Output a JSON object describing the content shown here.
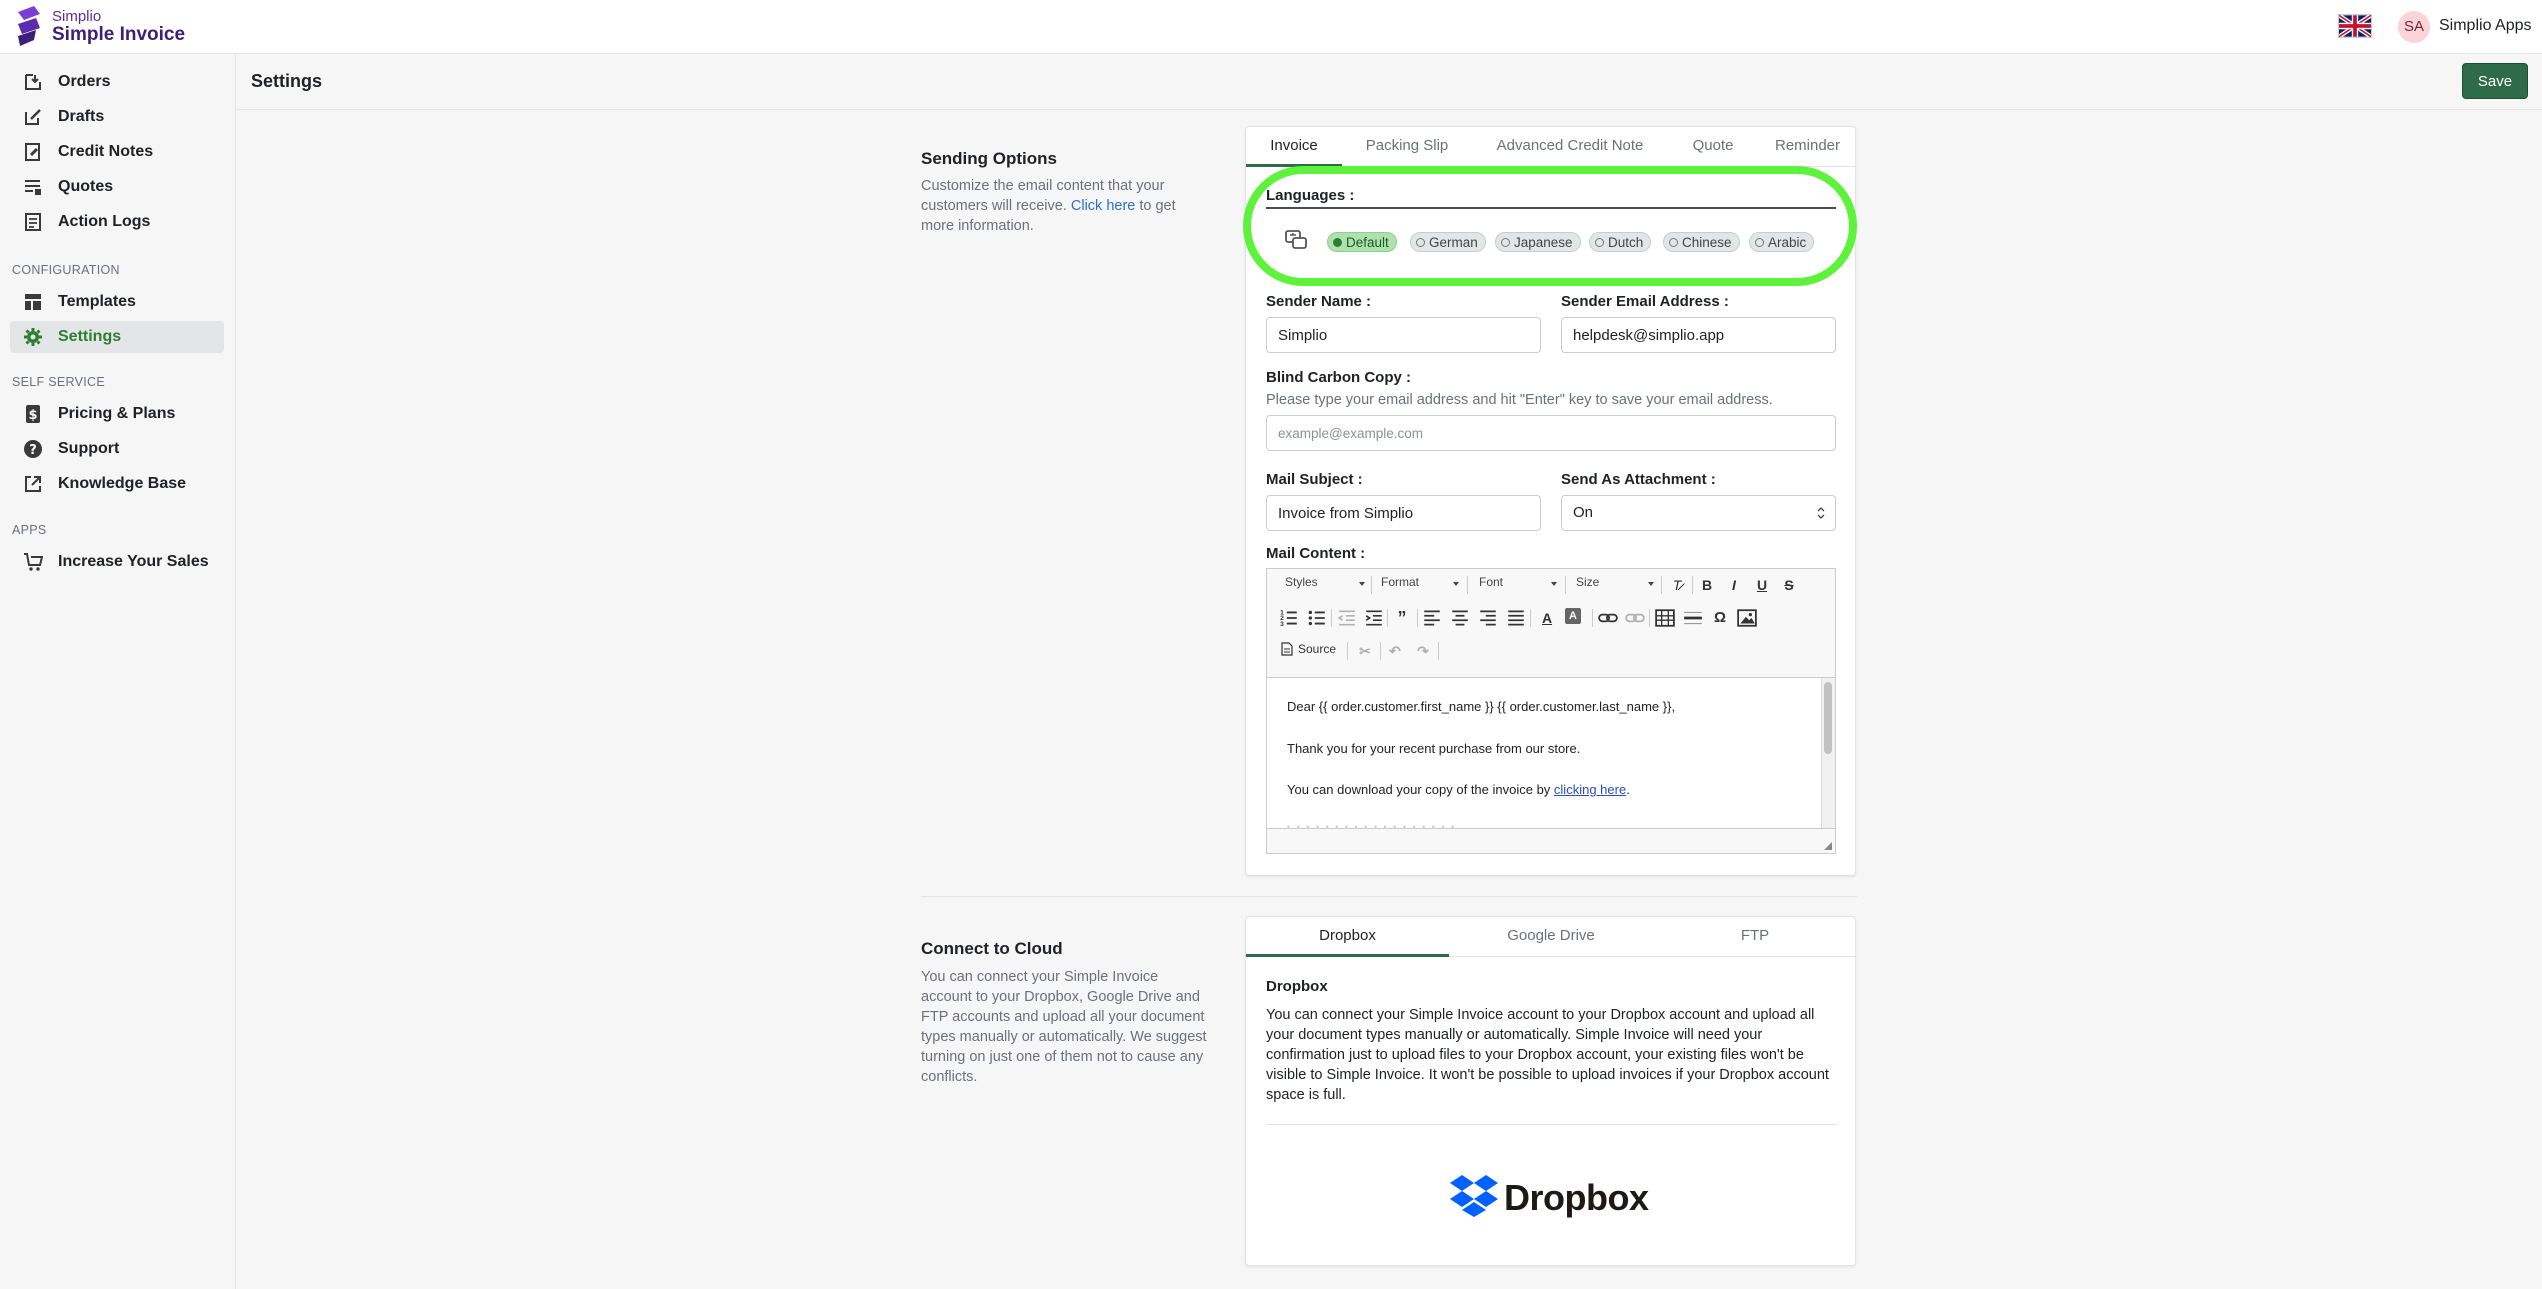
{
  "app": {
    "brand_top": "Simplio",
    "brand_main": "Simple Invoice",
    "user_initials": "SA",
    "user_name": "Simplio Apps"
  },
  "sidebar": {
    "items": [
      {
        "label": "Orders",
        "icon": "orders-icon"
      },
      {
        "label": "Drafts",
        "icon": "drafts-icon"
      },
      {
        "label": "Credit Notes",
        "icon": "credit-notes-icon"
      },
      {
        "label": "Quotes",
        "icon": "quotes-icon"
      },
      {
        "label": "Action Logs",
        "icon": "action-logs-icon"
      }
    ],
    "config_heading": "CONFIGURATION",
    "config_items": [
      {
        "label": "Templates",
        "icon": "templates-icon"
      },
      {
        "label": "Settings",
        "icon": "gear-icon",
        "active": true
      }
    ],
    "self_service_heading": "SELF SERVICE",
    "self_service_items": [
      {
        "label": "Pricing & Plans",
        "icon": "dollar-icon"
      },
      {
        "label": "Support",
        "icon": "help-icon"
      },
      {
        "label": "Knowledge Base",
        "icon": "external-link-icon"
      }
    ],
    "apps_heading": "APPS",
    "apps_items": [
      {
        "label": "Increase Your Sales",
        "icon": "cart-icon"
      }
    ]
  },
  "header": {
    "title": "Settings",
    "save_label": "Save"
  },
  "sending_options": {
    "title": "Sending Options",
    "desc_before": "Customize the email content that your customers will receive. ",
    "desc_link": "Click here",
    "desc_after": " to get more information.",
    "tabs": [
      "Invoice",
      "Packing Slip",
      "Advanced Credit Note",
      "Quote",
      "Reminder"
    ],
    "active_tab": "Invoice",
    "languages_label": "Languages :",
    "languages": [
      "Default",
      "German",
      "Japanese",
      "Dutch",
      "Chinese",
      "Arabic"
    ],
    "selected_language": "Default",
    "sender_name_label": "Sender Name :",
    "sender_name_value": "Simplio",
    "sender_email_label": "Sender Email Address :",
    "sender_email_value": "helpdesk@simplio.app",
    "bcc_label": "Blind Carbon Copy :",
    "bcc_help": "Please type your email address and hit \"Enter\" key to save your email address.",
    "bcc_placeholder": "example@example.com",
    "mail_subject_label": "Mail Subject :",
    "mail_subject_value": "Invoice from Simplio",
    "attachment_label": "Send As Attachment :",
    "attachment_value": "On",
    "mail_content_label": "Mail Content :",
    "toolbar": {
      "styles": "Styles",
      "format": "Format",
      "font": "Font",
      "size": "Size",
      "source": "Source"
    },
    "content_lines": {
      "line1": "Dear {{ order.customer.first_name }} {{ order.customer.last_name }},",
      "line2": "Thank you for your recent purchase from our store.",
      "line3_before": "You can download your copy of the invoice by ",
      "line3_link": "clicking here",
      "line3_after": "."
    }
  },
  "cloud": {
    "title": "Connect to Cloud",
    "desc": "You can connect your Simple Invoice account to your Dropbox, Google Drive and FTP accounts and upload all your document types manually or automatically. We suggest turning on just one of them not to cause any conflicts.",
    "tabs": [
      "Dropbox",
      "Google Drive",
      "FTP"
    ],
    "active_tab": "Dropbox",
    "panel_title": "Dropbox",
    "panel_text": "You can connect your Simple Invoice account to your Dropbox account and upload all your document types manually or automatically. Simple Invoice will need your confirmation just to upload files to your Dropbox account, your existing files won't be visible to Simple Invoice. It won't be possible to upload invoices if your Dropbox account space is full.",
    "logo_text": "Dropbox"
  },
  "colors": {
    "accent": "#2e6b48",
    "highlight": "#5ef23c",
    "dropbox_blue": "#0061fe"
  }
}
